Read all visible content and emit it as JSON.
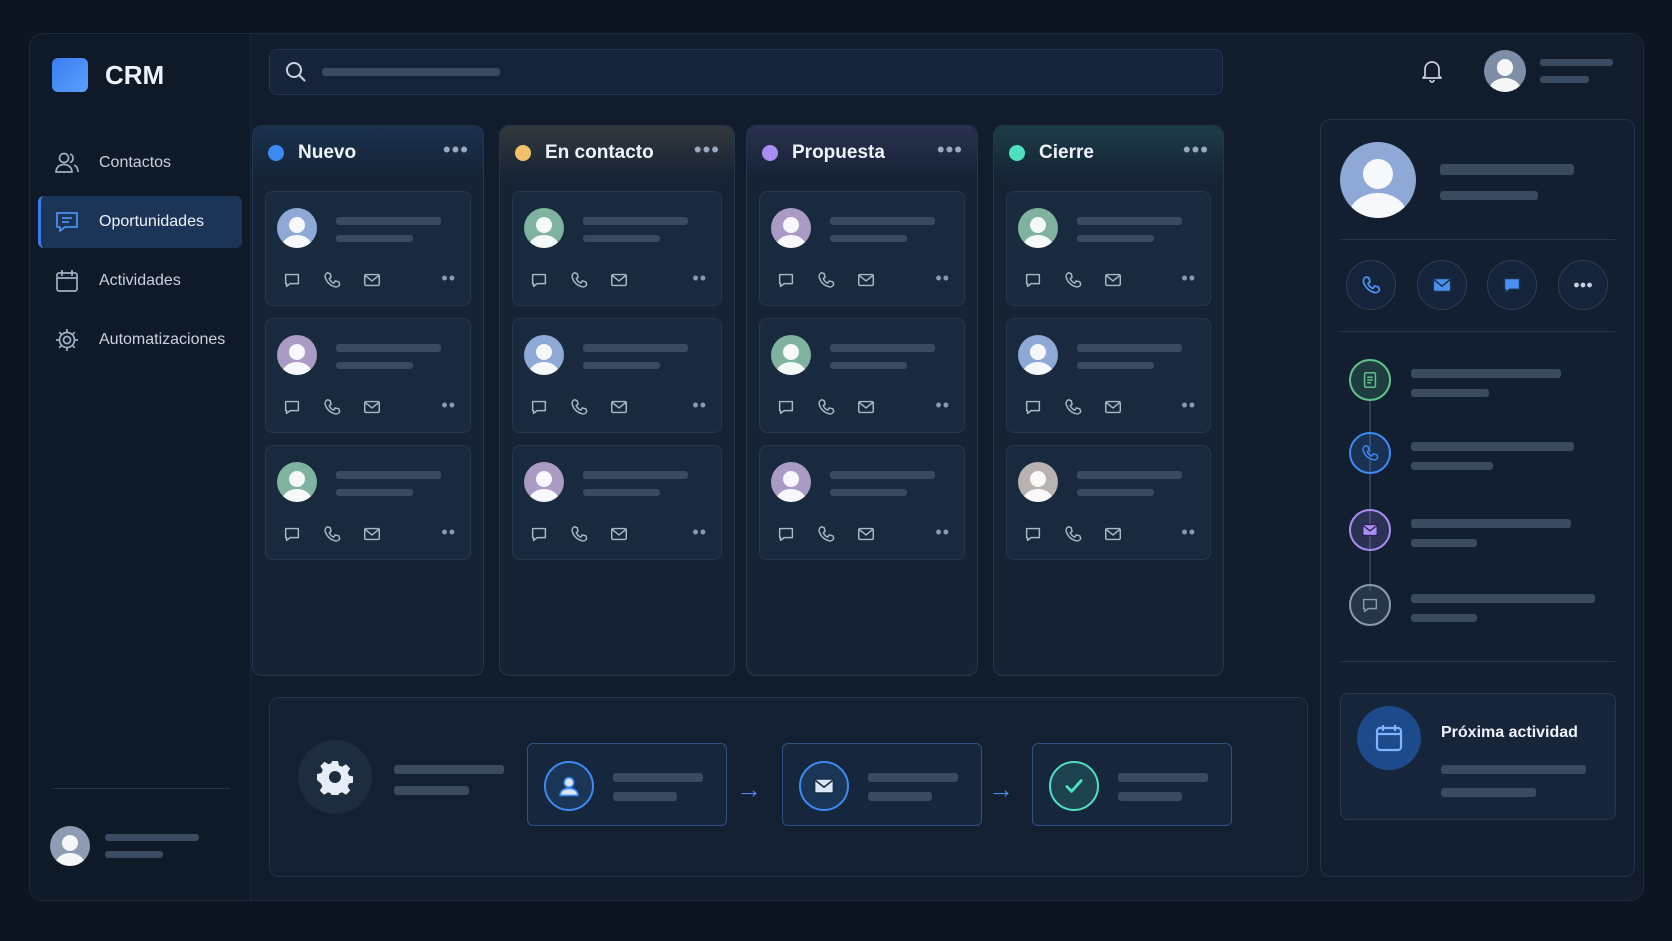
{
  "app": {
    "name": "CRM"
  },
  "sidebar": {
    "items": [
      {
        "label": "Contactos",
        "icon": "users-icon",
        "active": false
      },
      {
        "label": "Oportunidades",
        "icon": "chat-icon",
        "active": true
      },
      {
        "label": "Actividades",
        "icon": "calendar-icon",
        "active": false
      },
      {
        "label": "Automatizaciones",
        "icon": "gear-icon",
        "active": false
      }
    ]
  },
  "pipeline": {
    "columns": [
      {
        "title": "Nuevo",
        "color": "#3d8bf2",
        "avatars": [
          "#8fa9d6",
          "#a99bc4",
          "#7fb39f"
        ]
      },
      {
        "title": "En contacto",
        "color": "#f2c26a",
        "avatars": [
          "#7fb39f",
          "#8fa9d6",
          "#a99bc4"
        ]
      },
      {
        "title": "Propuesta",
        "color": "#a98df2",
        "avatars": [
          "#a99bc4",
          "#7fb39f",
          "#a99bc4"
        ]
      },
      {
        "title": "Cierre",
        "color": "#4fe0c0",
        "avatars": [
          "#7fb39f",
          "#8fa9d6",
          "#b8b3b0"
        ]
      }
    ]
  },
  "detail": {
    "actions": [
      "phone-icon",
      "mail-icon",
      "chat-icon",
      "more-icon"
    ],
    "timeline": [
      {
        "icon": "document-icon",
        "color": "#5fc48a"
      },
      {
        "icon": "phone-icon",
        "color": "#3d8bf2"
      },
      {
        "icon": "mail-icon",
        "color": "#a98df2"
      },
      {
        "icon": "chat-icon",
        "color": "#8a9ab0"
      }
    ],
    "next_activity": {
      "title": "Próxima actividad"
    }
  },
  "automation": {
    "steps": [
      {
        "icon": "user-icon",
        "color": "#3d8bf2"
      },
      {
        "icon": "mail-icon",
        "color": "#3d8bf2"
      },
      {
        "icon": "check-icon",
        "color": "#4fe0c0"
      }
    ]
  }
}
